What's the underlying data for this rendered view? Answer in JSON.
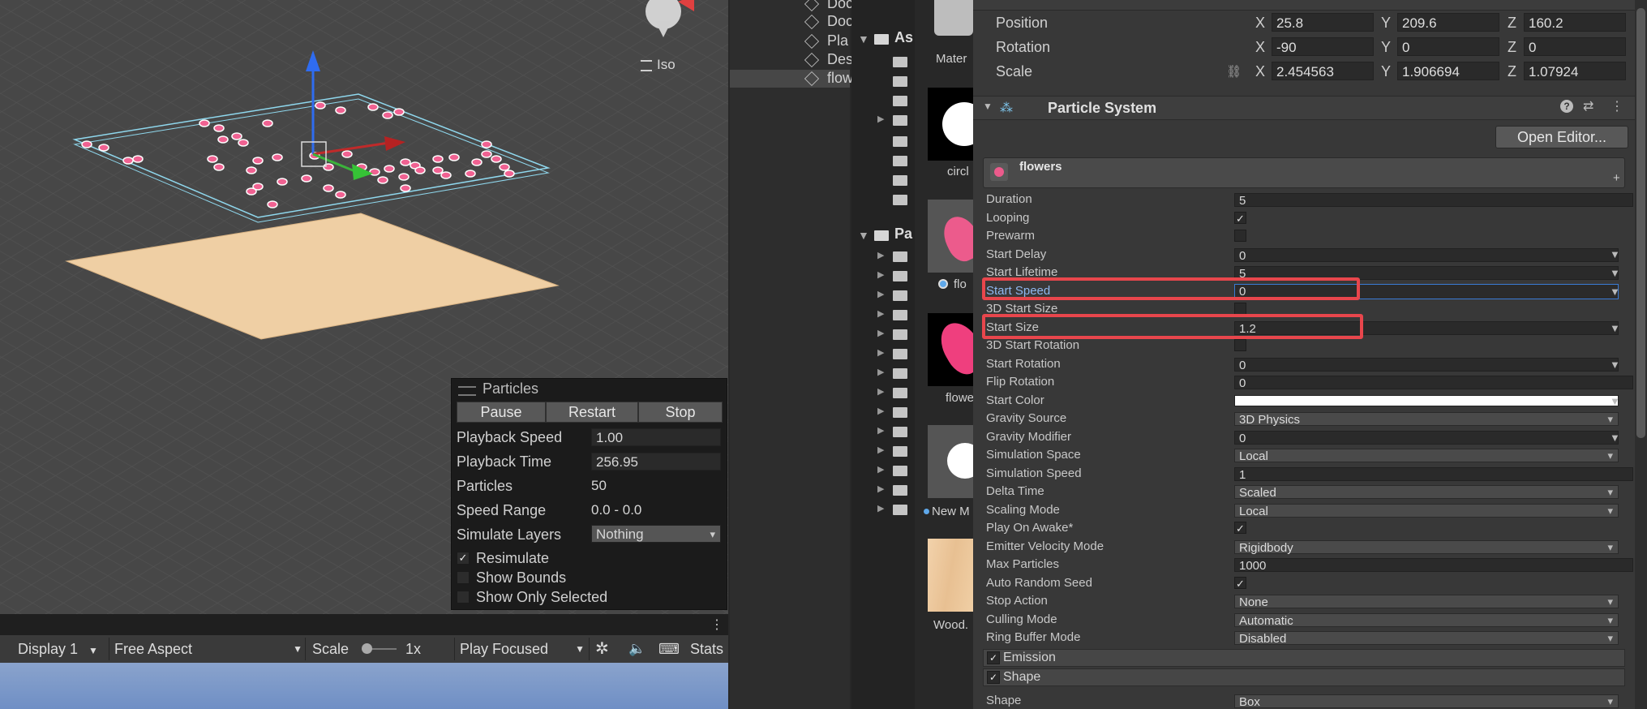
{
  "scene": {
    "view_mode_label": "Iso"
  },
  "particles_panel": {
    "title": "Particles",
    "buttons": {
      "pause": "Pause",
      "restart": "Restart",
      "stop": "Stop"
    },
    "playback_speed_label": "Playback Speed",
    "playback_speed": "1.00",
    "playback_time_label": "Playback Time",
    "playback_time": "256.95",
    "particles_label": "Particles",
    "particles": "50",
    "speed_range_label": "Speed Range",
    "speed_range": "0.0 - 0.0",
    "simulate_layers_label": "Simulate Layers",
    "simulate_layers": "Nothing",
    "resimulate_label": "Resimulate",
    "show_bounds_label": "Show Bounds",
    "show_only_selected_label": "Show Only Selected"
  },
  "game_toolbar": {
    "display": "Display 1",
    "aspect": "Free Aspect",
    "scale_label": "Scale",
    "scale_value": "1x",
    "play_mode": "Play Focused",
    "stats": "Stats"
  },
  "hierarchy": {
    "items": [
      "Doc",
      "Doc",
      "Pla",
      "Des",
      "flow"
    ]
  },
  "project": {
    "tree_headers": [
      "As",
      "Pa"
    ],
    "thumbnails": [
      "Mater",
      "circl",
      "flo",
      "flowe",
      "New M",
      "Wood."
    ]
  },
  "inspector": {
    "transform": {
      "position_label": "Position",
      "rotation_label": "Rotation",
      "scale_label": "Scale",
      "position": {
        "x": "25.8",
        "y": "209.6",
        "z": "160.2"
      },
      "rotation": {
        "x": "-90",
        "y": "0",
        "z": "0"
      },
      "scale": {
        "x": "2.454563",
        "y": "1.906694",
        "z": "1.07924"
      }
    },
    "particle_system": {
      "title": "Particle System",
      "open_editor": "Open Editor...",
      "name": "flowers",
      "properties": {
        "duration_label": "Duration",
        "duration": "5",
        "looping_label": "Looping",
        "prewarm_label": "Prewarm",
        "start_delay_label": "Start Delay",
        "start_delay": "0",
        "start_lifetime_label": "Start Lifetime",
        "start_lifetime": "5",
        "start_speed_label": "Start Speed",
        "start_speed": "0",
        "start_size_3d_label": "3D Start Size",
        "start_size_label": "Start Size",
        "start_size": "1.2",
        "start_rotation_3d_label": "3D Start Rotation",
        "start_rotation_label": "Start Rotation",
        "start_rotation": "0",
        "flip_rotation_label": "Flip Rotation",
        "flip_rotation": "0",
        "start_color_label": "Start Color",
        "gravity_source_label": "Gravity Source",
        "gravity_source": "3D Physics",
        "gravity_modifier_label": "Gravity Modifier",
        "gravity_modifier": "0",
        "simulation_space_label": "Simulation Space",
        "simulation_space": "Local",
        "simulation_speed_label": "Simulation Speed",
        "simulation_speed": "1",
        "delta_time_label": "Delta Time",
        "delta_time": "Scaled",
        "scaling_mode_label": "Scaling Mode",
        "scaling_mode": "Local",
        "play_on_awake_label": "Play On Awake*",
        "emitter_velocity_mode_label": "Emitter Velocity Mode",
        "emitter_velocity_mode": "Rigidbody",
        "max_particles_label": "Max Particles",
        "max_particles": "1000",
        "auto_random_seed_label": "Auto Random Seed",
        "stop_action_label": "Stop Action",
        "stop_action": "None",
        "culling_mode_label": "Culling Mode",
        "culling_mode": "Automatic",
        "ring_buffer_mode_label": "Ring Buffer Mode",
        "ring_buffer_mode": "Disabled"
      },
      "modules": {
        "emission": "Emission",
        "shape": "Shape",
        "shape_type_label": "Shape",
        "shape_type": "Box"
      }
    }
  },
  "colors": {
    "highlight_box": "#e8464c",
    "selected_field_border": "#3a7bd5",
    "particle_pink": "#f06292"
  }
}
